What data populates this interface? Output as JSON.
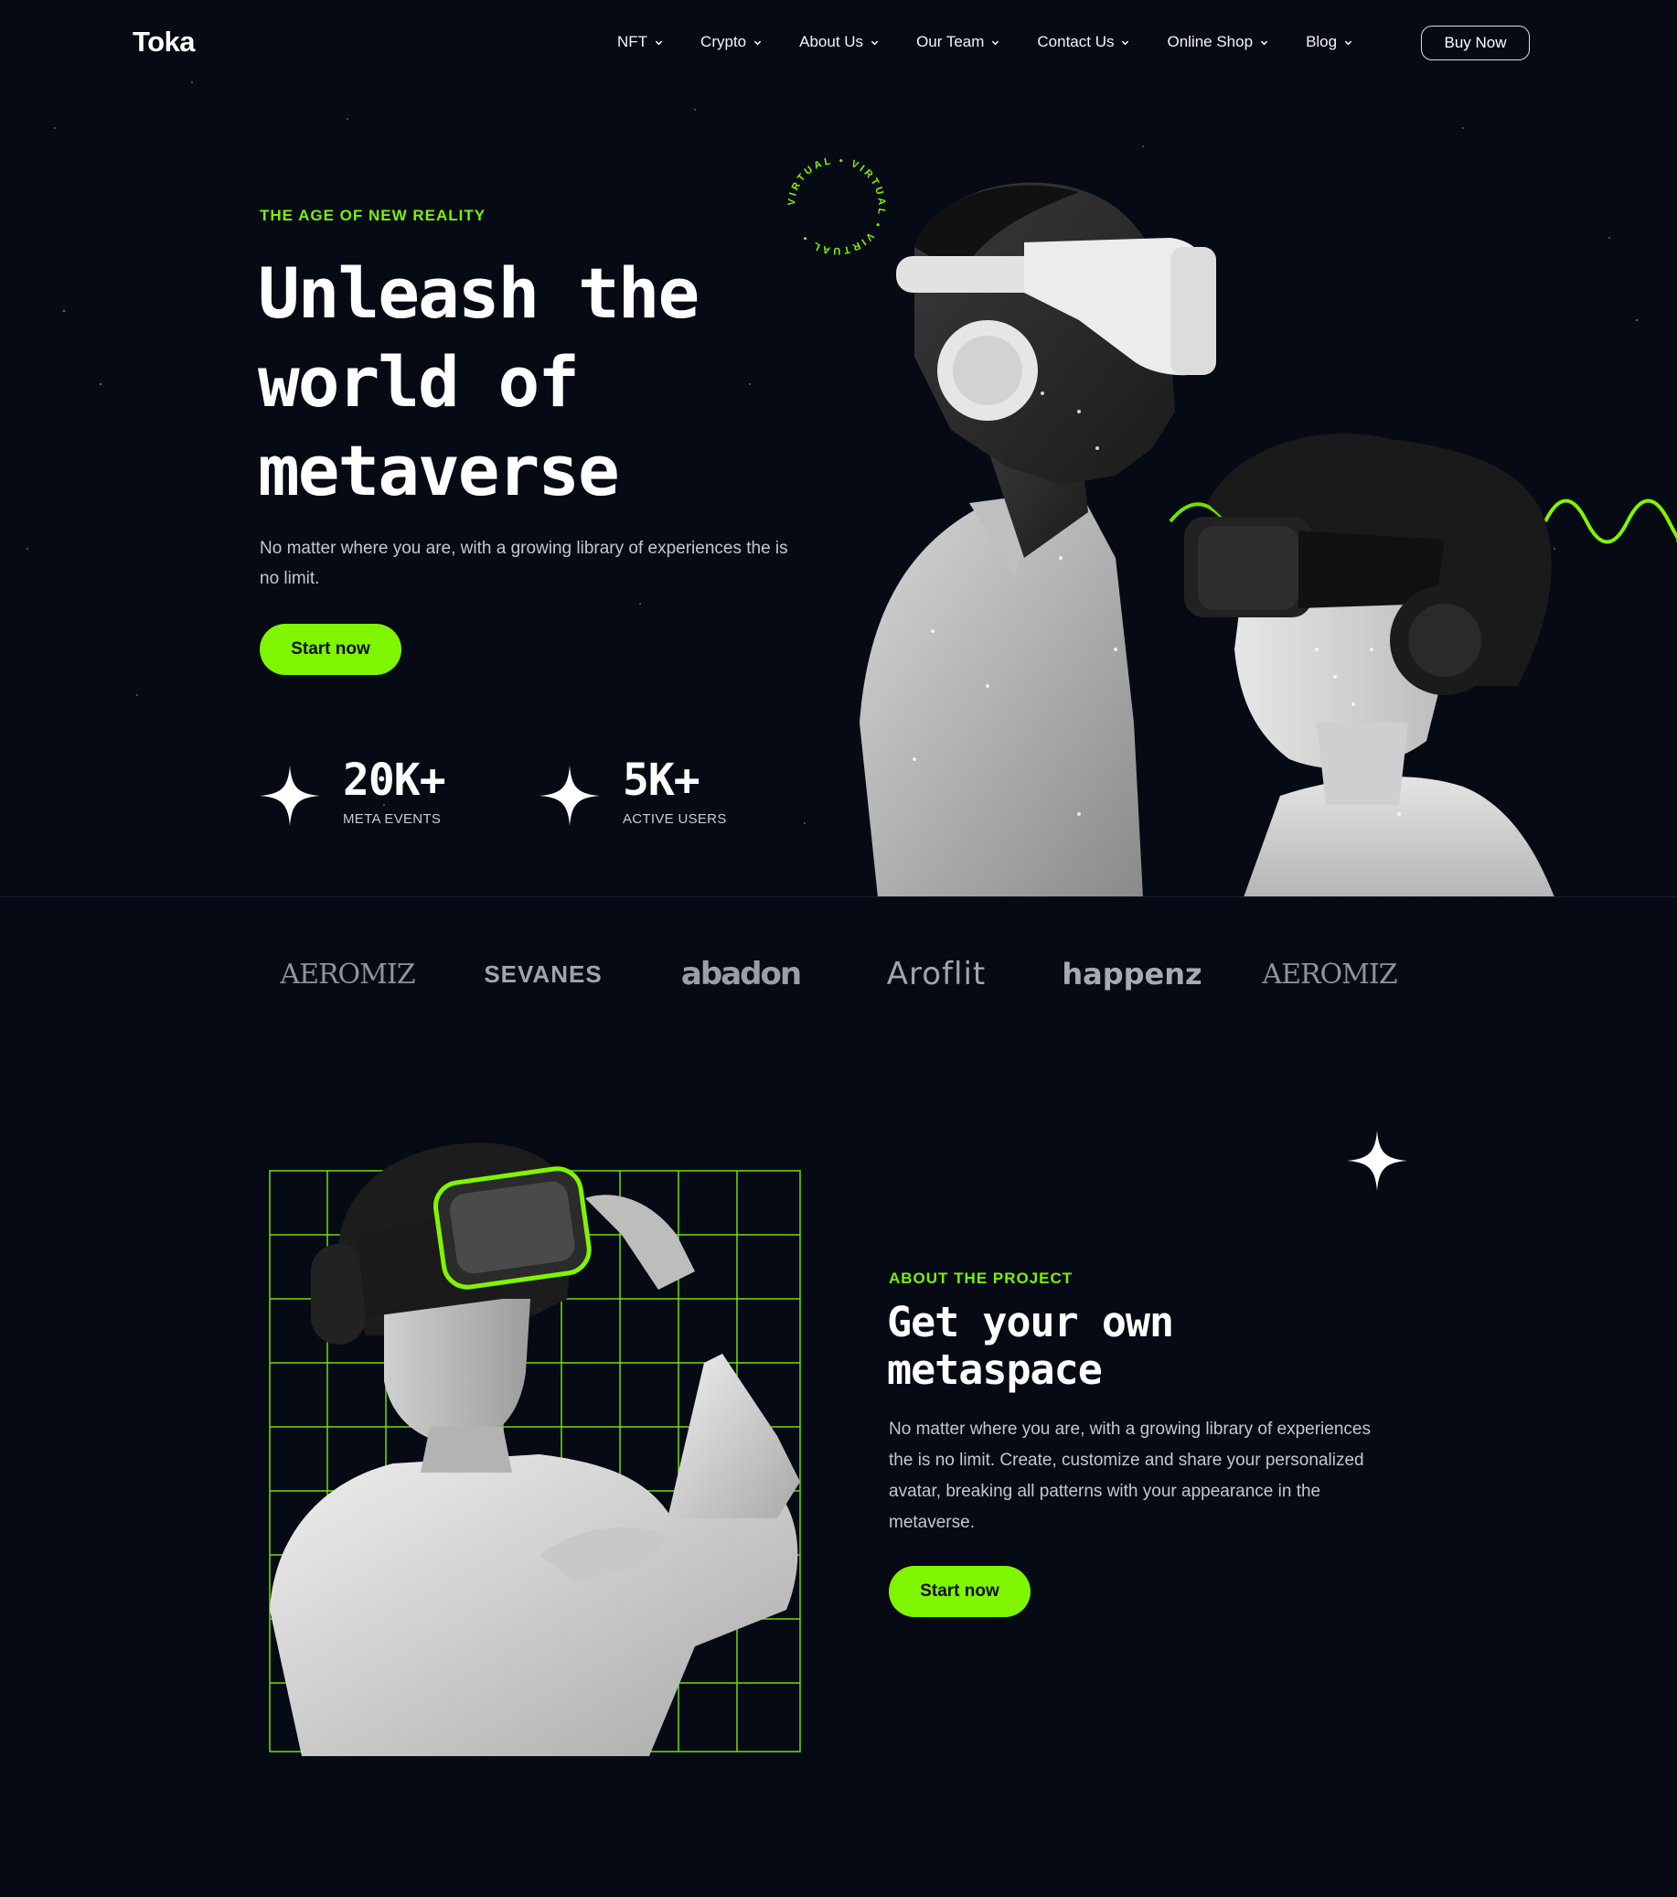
{
  "nav": {
    "logo": "Toka",
    "items": [
      {
        "label": "NFT"
      },
      {
        "label": "Crypto"
      },
      {
        "label": "About Us"
      },
      {
        "label": "Our Team"
      },
      {
        "label": "Contact Us"
      },
      {
        "label": "Online Shop"
      },
      {
        "label": "Blog"
      }
    ],
    "buy_label": "Buy Now"
  },
  "hero": {
    "eyebrow": "THE AGE OF NEW REALITY",
    "title_line1": "Unleash the",
    "title_line2": "world of",
    "title_line3": "metaverse",
    "description": "No matter where you are, with a growing library of experiences the is no limit.",
    "cta_label": "Start now",
    "ring_text": "VIRTUAL • VIRTUAL • VIRTUAL • ",
    "stats": [
      {
        "value": "20K+",
        "label": "META EVENTS"
      },
      {
        "value": "5K+",
        "label": "ACTIVE USERS"
      }
    ]
  },
  "partners": [
    {
      "name": "AEROMIZ"
    },
    {
      "name": "SEVANES"
    },
    {
      "name": "abadon"
    },
    {
      "name": "Aroflit"
    },
    {
      "name": "happenz"
    },
    {
      "name": "AEROMIZ"
    }
  ],
  "about": {
    "eyebrow": "ABOUT THE PROJECT",
    "title_line1": "Get your own",
    "title_line2": "metaspace",
    "description": "No matter where you are, with a growing library of experiences the is no limit. Create, customize and share your personalized avatar, breaking all patterns with your appearance in the metaverse.",
    "cta_label": "Start now"
  },
  "colors": {
    "background": "#050a14",
    "accent": "#7ff500",
    "text": "#ffffff",
    "muted": "#c4c8cd"
  },
  "icons": {
    "chevron": "chevron-down-icon",
    "sparkle": "sparkle-icon"
  }
}
